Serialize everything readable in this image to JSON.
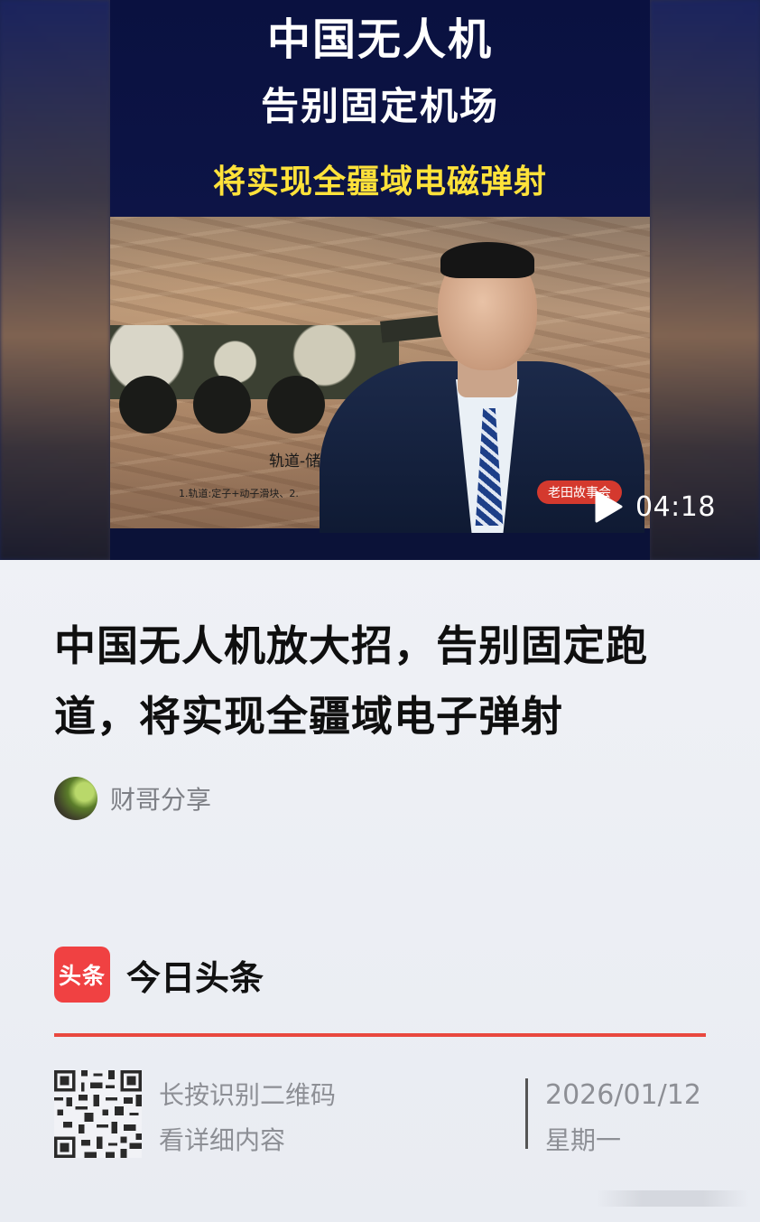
{
  "video": {
    "overlay_line1": "中国无人机",
    "overlay_line2": "告别固定机场",
    "overlay_line3": "将实现全疆域电磁弹射",
    "scene_caption": "轨道-储能",
    "scene_subcaption": "1.轨道:定子+动子滑块、2.",
    "channel_badge": "老田故事会",
    "duration": "04:18",
    "play_icon": "play-icon"
  },
  "article": {
    "title": "中国无人机放大招，告别固定跑道，将实现全疆域电子弹射",
    "author": "财哥分享"
  },
  "brand": {
    "logo_text": "头条",
    "name": "今日头条",
    "accent_color": "#f04142",
    "divider_color": "#e9483f"
  },
  "footer": {
    "qr_hint_line1": "长按识别二维码",
    "qr_hint_line2": "看详细内容",
    "date": "2026/01/12",
    "weekday": "星期一"
  }
}
